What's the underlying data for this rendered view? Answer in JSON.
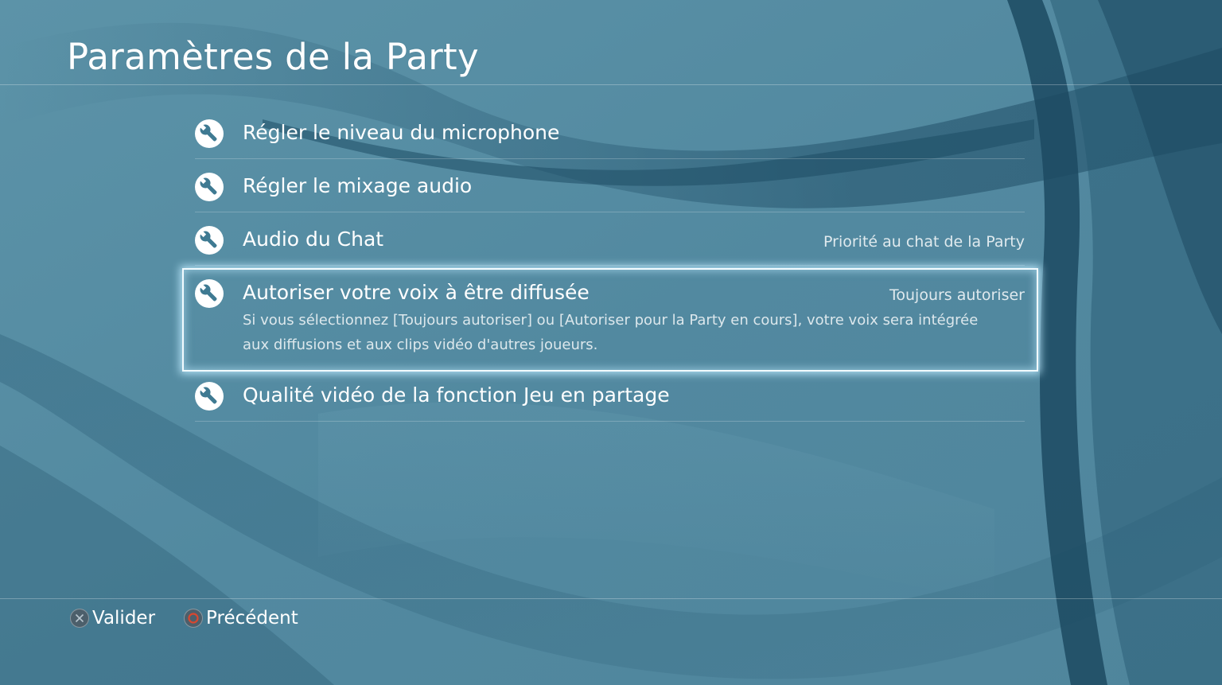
{
  "screen": {
    "title": "Paramètres de la Party"
  },
  "menu": {
    "items": [
      {
        "label": "Régler le niveau du microphone",
        "value": "",
        "description": "",
        "selected": false,
        "icon": "wrench-icon"
      },
      {
        "label": "Régler le mixage audio",
        "value": "",
        "description": "",
        "selected": false,
        "icon": "wrench-icon"
      },
      {
        "label": "Audio du Chat",
        "value": "Priorité au chat de la Party",
        "description": "",
        "selected": false,
        "icon": "wrench-icon"
      },
      {
        "label": "Autoriser votre voix à être diffusée",
        "value": "Toujours autoriser",
        "description": "Si vous sélectionnez [Toujours autoriser] ou [Autoriser pour la Party en cours], votre voix sera intégrée aux diffusions et aux clips vidéo d'autres joueurs.",
        "selected": true,
        "icon": "wrench-icon"
      },
      {
        "label": "Qualité vidéo de la fonction Jeu en partage",
        "value": "",
        "description": "",
        "selected": false,
        "icon": "wrench-icon"
      }
    ]
  },
  "footer": {
    "confirm_label": "Valider",
    "confirm_icon": "cross-button-icon",
    "back_label": "Précédent",
    "back_icon": "circle-button-icon"
  },
  "colors": {
    "background": "#538aa0",
    "wave_dark": "#1f4f68",
    "focus_glow": "#bfeaff",
    "circle_button": "#c4402f"
  }
}
